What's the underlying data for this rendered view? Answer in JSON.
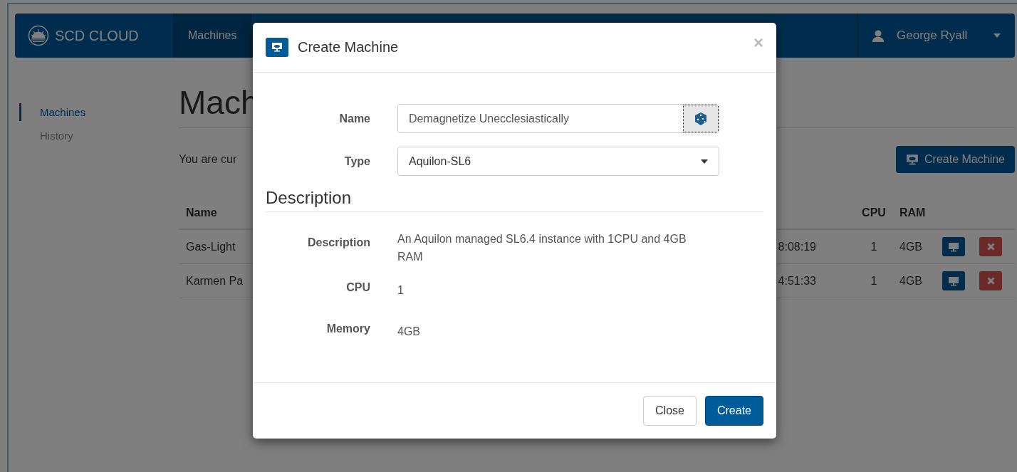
{
  "navbar": {
    "brand": "SCD CLOUD",
    "nav_items": [
      {
        "label": "Machines",
        "selected": true
      }
    ],
    "user": "George Ryall"
  },
  "sidebar": {
    "items": [
      {
        "label": "Machines",
        "selected": true
      },
      {
        "label": "History",
        "selected": false
      }
    ]
  },
  "page": {
    "heading": "Mach",
    "intro": "You are cur",
    "create_button": "Create Machine"
  },
  "table": {
    "columns": [
      {
        "label": "Name"
      },
      {
        "label": "CPU"
      },
      {
        "label": "RAM"
      }
    ],
    "rows": [
      {
        "name": "Gas-Light",
        "time": "8:08:19",
        "cpu": "1",
        "ram": "4GB"
      },
      {
        "name": "Karmen Pa",
        "time": "4:51:33",
        "cpu": "1",
        "ram": "4GB"
      }
    ]
  },
  "modal": {
    "title": "Create Machine",
    "close": "×",
    "fields": [
      {
        "label": "Name",
        "kind": "text",
        "value": "Demagnetize Unecclesiastically"
      },
      {
        "label": "Type",
        "kind": "select",
        "value": "Aquilon-SL6"
      }
    ],
    "section_heading": "Description",
    "details": [
      {
        "label": "Description",
        "value": "An Aquilon managed SL6.4 instance with 1CPU and 4GB RAM"
      },
      {
        "label": "CPU",
        "value": "1"
      },
      {
        "label": "Memory",
        "value": "4GB"
      }
    ],
    "buttons": [
      {
        "label": "Close",
        "kind": "default"
      },
      {
        "label": "Create",
        "kind": "primary"
      }
    ]
  }
}
